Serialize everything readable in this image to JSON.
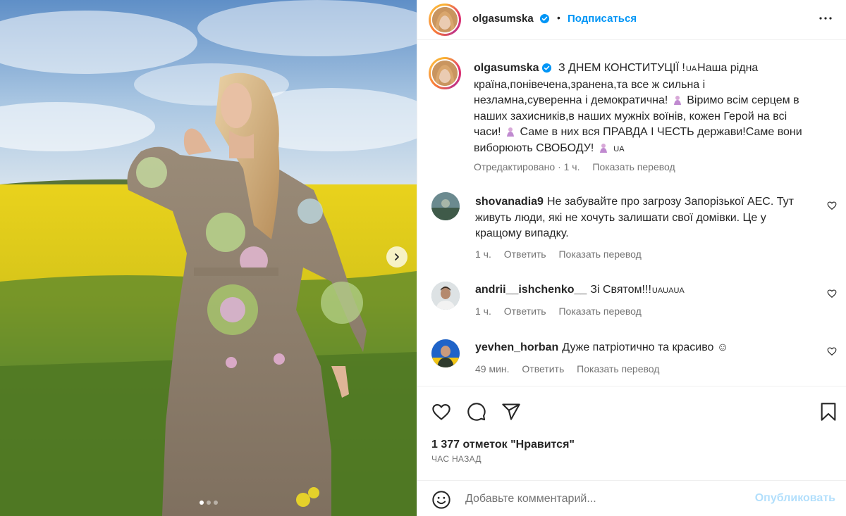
{
  "post": {
    "author": "olgasumska",
    "follow_label": "Подписаться",
    "separator": "•"
  },
  "caption": {
    "author": "olgasumska",
    "part1": "З ДНЕМ КОНСТИТУЦІЇ !",
    "flag1": "UA",
    "part2": "Наша рідна країна,понівечена,зранена,та все ж сильна і незламна,суверенна і демократична!",
    "part3": "Віримо всім серцем в наших захисників,в наших мужніх воїнів, кожен Герой на всі часи!",
    "part4": "Саме в них вся ПРАВДА І ЧЕСТЬ держави!Саме вони виборюють СВОБОДУ!",
    "flag2": "UA",
    "edited": "Отредактировано · 1 ч.",
    "translate": "Показать перевод"
  },
  "comments": [
    {
      "user": "shovanadia9",
      "text": "Не забувайте про загрозу Запорізької АЕС. Тут живуть люди, які не хочуть залишати свої домівки. Це у кращому випадку.",
      "time": "1 ч.",
      "reply": "Ответить",
      "translate": "Показать перевод"
    },
    {
      "user": "andrii__ishchenko__",
      "text": "Зі Святом!!!",
      "flags": "UAUAUA",
      "time": "1 ч.",
      "reply": "Ответить",
      "translate": "Показать перевод"
    },
    {
      "user": "yevhen_horban",
      "text": "Дуже патріотично та красиво ☺",
      "time": "49 мин.",
      "reply": "Ответить",
      "translate": "Показать перевод"
    }
  ],
  "actions": {
    "likes": "1 377 отметок \"Нравится\"",
    "time_ago": "ЧАС НАЗАД",
    "icons": [
      "heart-icon",
      "comment-icon",
      "share-icon",
      "bookmark-icon"
    ]
  },
  "composer": {
    "placeholder": "Добавьте комментарий...",
    "post_label": "Опубликовать"
  },
  "carousel": {
    "total_slides": 3,
    "active_slide": 1
  },
  "colors": {
    "link": "#0095f6",
    "muted": "#737373",
    "verified": "#0095f6",
    "post_disabled": "#b2dffc"
  }
}
